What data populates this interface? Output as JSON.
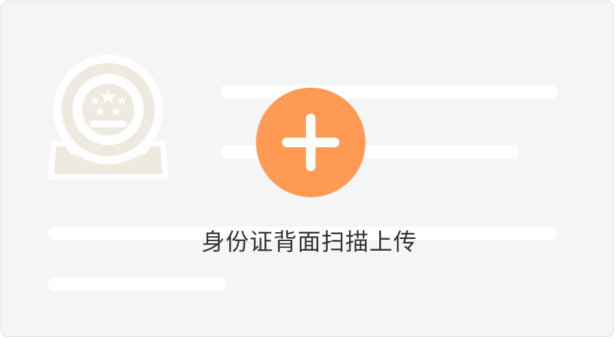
{
  "upload": {
    "label": "身份证背面扫描上传"
  },
  "icons": {
    "emblem": "national-emblem-icon",
    "plus": "plus-icon"
  },
  "colors": {
    "card_background": "#f5f5f5",
    "accent": "#ff9a55",
    "placeholder": "#ffffff",
    "emblem": "#efeae0",
    "text": "#333333"
  }
}
